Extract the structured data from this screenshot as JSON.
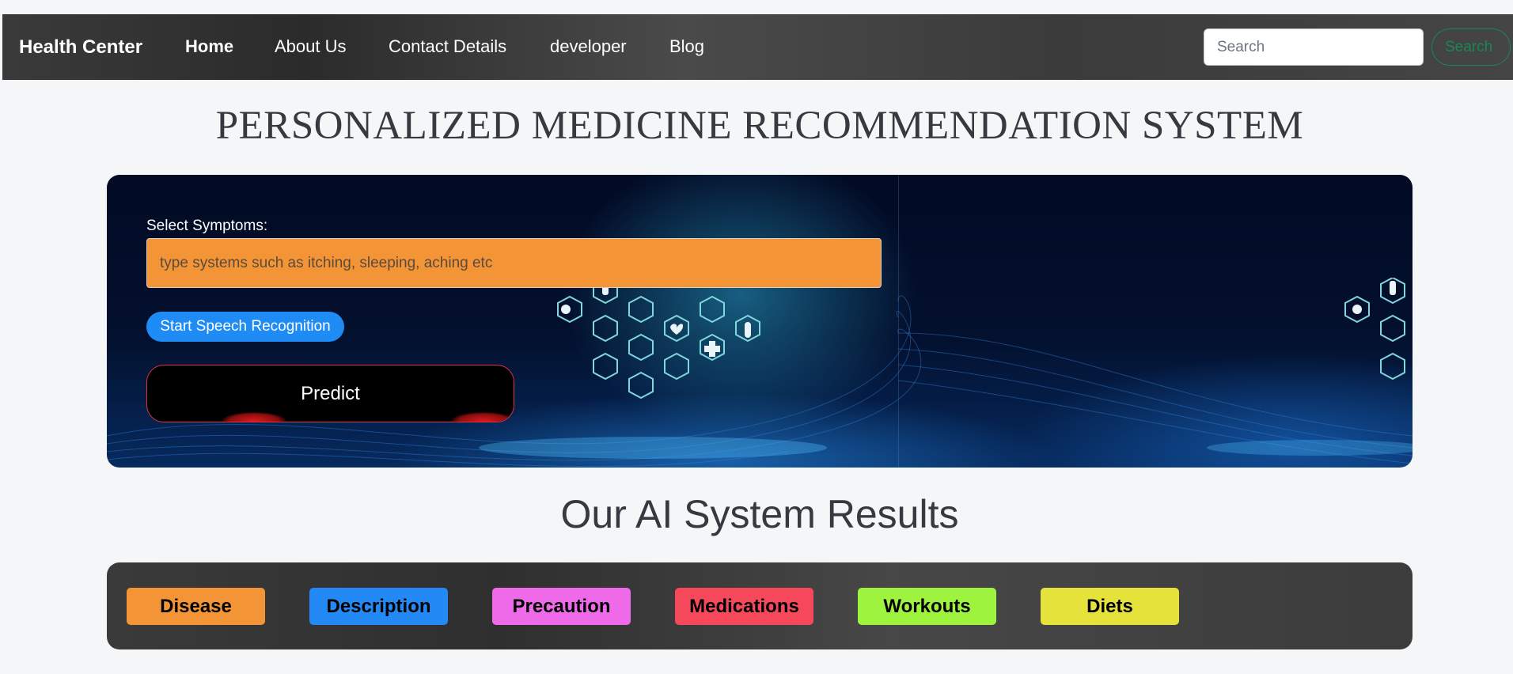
{
  "navbar": {
    "brand": "Health Center",
    "links": [
      {
        "label": "Home",
        "active": true
      },
      {
        "label": "About Us",
        "active": false
      },
      {
        "label": "Contact Details",
        "active": false
      },
      {
        "label": "developer",
        "active": false
      },
      {
        "label": "Blog",
        "active": false
      }
    ],
    "search": {
      "placeholder": "Search",
      "value": "",
      "button_label": "Search"
    }
  },
  "page_title": "PERSONALIZED MEDICINE RECOMMENDATION SYSTEM",
  "hero": {
    "symptoms_label": "Select Symptoms:",
    "symptoms_placeholder": "type systems such as itching, sleeping, aching etc",
    "symptoms_value": "",
    "speech_button": "Start Speech Recognition",
    "predict_button": "Predict",
    "illustration_icons": [
      "pills-icon",
      "inhaler-icon",
      "dna-icon",
      "atom-icon",
      "brain-icon",
      "heart-icon",
      "capsule-icon",
      "medical-cross-icon",
      "syringe-icon",
      "thermometer-icon",
      "test-tubes-icon",
      "monitor-icon"
    ]
  },
  "results": {
    "title": "Our AI System Results",
    "buttons": [
      {
        "label": "Disease",
        "color": "#f39436"
      },
      {
        "label": "Description",
        "color": "#2389f4"
      },
      {
        "label": "Precaution",
        "color": "#ef6ae8"
      },
      {
        "label": "Medications",
        "color": "#f5485a"
      },
      {
        "label": "Workouts",
        "color": "#9ef33e"
      },
      {
        "label": "Diets",
        "color": "#e5e23b"
      }
    ]
  }
}
